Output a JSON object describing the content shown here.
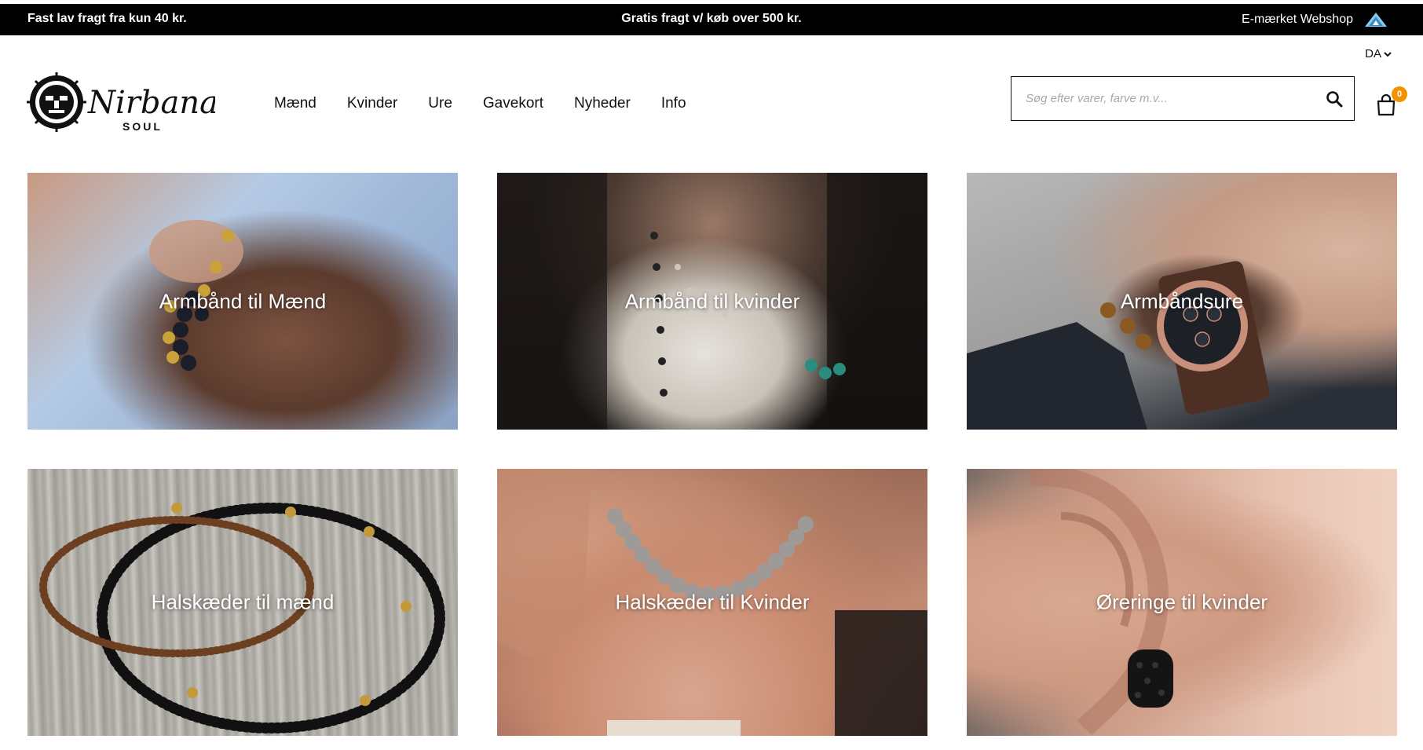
{
  "topbar": {
    "left_text": "Fast lav fragt fra kun 40 kr.",
    "center_text": "Gratis fragt v/ køb over 500 kr.",
    "right_text": "E-mærket Webshop",
    "right_icon": "emaerket-icon"
  },
  "header": {
    "language": "DA",
    "logo": {
      "wordmark": "Nirbana",
      "subline": "SOUL"
    },
    "nav": [
      "Mænd",
      "Kvinder",
      "Ure",
      "Gavekort",
      "Nyheder",
      "Info"
    ],
    "search": {
      "placeholder": "Søg efter varer, farve m.v...",
      "value": ""
    },
    "cart": {
      "count": "0"
    }
  },
  "categories": [
    {
      "label": "Armbånd til Mænd"
    },
    {
      "label": "Armbånd til kvinder"
    },
    {
      "label": "Armbåndsure"
    },
    {
      "label": "Halskæder til mænd"
    },
    {
      "label": "Halskæder til Kvinder"
    },
    {
      "label": "Øreringe til kvinder"
    }
  ],
  "colors": {
    "topbar_bg": "#000000",
    "cart_badge": "#f39200",
    "text": "#111111"
  }
}
